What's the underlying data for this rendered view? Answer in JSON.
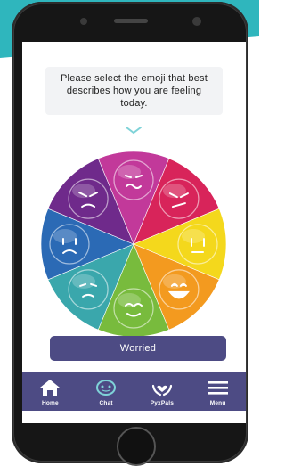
{
  "prompt": {
    "text": "Please select the emoji that best describes how you are feeling today."
  },
  "wheel": {
    "segments": [
      {
        "mood": "worried",
        "color": "#c2399a",
        "icon": "worried-face-icon"
      },
      {
        "mood": "frustrated",
        "color": "#d8245a",
        "icon": "frustrated-face-icon"
      },
      {
        "mood": "bored",
        "color": "#f4d81c",
        "icon": "neutral-face-icon"
      },
      {
        "mood": "happy",
        "color": "#f39a1f",
        "icon": "happy-face-icon"
      },
      {
        "mood": "calm",
        "color": "#78bb3d",
        "icon": "calm-face-icon"
      },
      {
        "mood": "sick",
        "color": "#3aa7ac",
        "icon": "sick-face-icon"
      },
      {
        "mood": "sad",
        "color": "#2b6ab5",
        "icon": "sad-face-icon"
      },
      {
        "mood": "angry",
        "color": "#6f2a8b",
        "icon": "angry-face-icon"
      }
    ]
  },
  "selection": {
    "label": "Worried"
  },
  "tabbar": {
    "tabs": [
      {
        "label": "Home",
        "icon": "home-icon"
      },
      {
        "label": "Chat",
        "icon": "chat-robot-icon",
        "active": true
      },
      {
        "label": "PyxPals",
        "icon": "hands-heart-icon"
      },
      {
        "label": "Menu",
        "icon": "hamburger-icon"
      }
    ],
    "background": "#4d4b84",
    "active_color": "#7fd3d8"
  }
}
